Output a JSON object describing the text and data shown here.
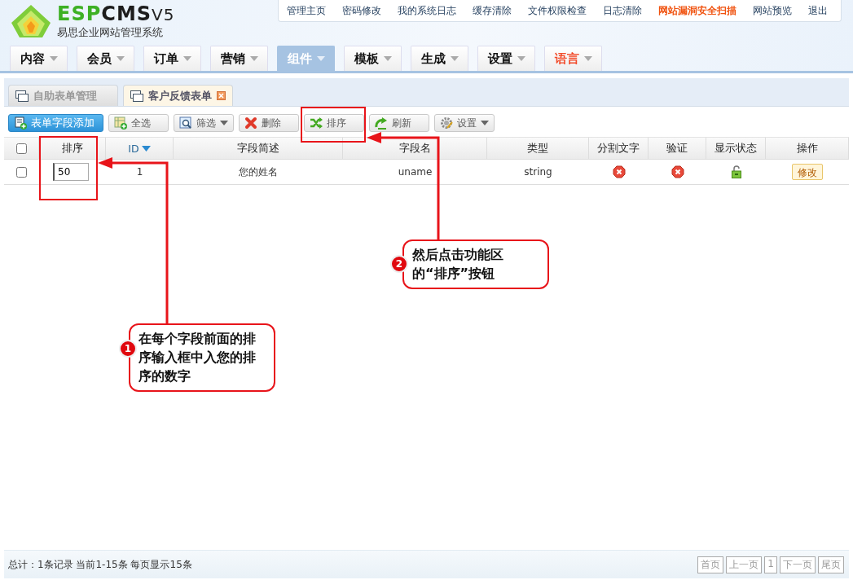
{
  "logo": {
    "brand": [
      {
        "text": "ESP",
        "color": "#3db024"
      },
      {
        "text": "CMS",
        "color": "#1d1d1d"
      }
    ],
    "version": "V5",
    "subtitle": "易思企业网站管理系统"
  },
  "top_links": [
    {
      "label": "管理主页",
      "highlighted": false
    },
    {
      "label": "密码修改",
      "highlighted": false
    },
    {
      "label": "我的系统日志",
      "highlighted": false
    },
    {
      "label": "缓存清除",
      "highlighted": false
    },
    {
      "label": "文件权限检查",
      "highlighted": false
    },
    {
      "label": "日志清除",
      "highlighted": false
    },
    {
      "label": "网站漏洞安全扫描",
      "highlighted": true
    },
    {
      "label": "网站预览",
      "highlighted": false
    },
    {
      "label": "退出",
      "highlighted": false
    }
  ],
  "nav_tabs": [
    {
      "label": "内容",
      "selected": false,
      "highlighted": false
    },
    {
      "label": "会员",
      "selected": false,
      "highlighted": false
    },
    {
      "label": "订单",
      "selected": false,
      "highlighted": false
    },
    {
      "label": "营销",
      "selected": false,
      "highlighted": false
    },
    {
      "label": "组件",
      "selected": true,
      "highlighted": false
    },
    {
      "label": "模板",
      "selected": false,
      "highlighted": false
    },
    {
      "label": "生成",
      "selected": false,
      "highlighted": false
    },
    {
      "label": "设置",
      "selected": false,
      "highlighted": false
    },
    {
      "label": "语言",
      "selected": false,
      "highlighted": true
    }
  ],
  "sub_tabs": [
    {
      "label": "自助表单管理",
      "selected": false,
      "closable": false
    },
    {
      "label": "客户反馈表单",
      "selected": true,
      "closable": true
    }
  ],
  "toolbar": [
    {
      "label": "表单字段添加",
      "kind": "add",
      "primary": true,
      "dropdown": false
    },
    {
      "label": "全选",
      "kind": "select-all",
      "primary": false,
      "dropdown": false
    },
    {
      "label": "筛选",
      "kind": "filter",
      "primary": false,
      "dropdown": true
    },
    {
      "label": "删除",
      "kind": "delete",
      "primary": false,
      "dropdown": false
    },
    {
      "label": "排序",
      "kind": "sort",
      "primary": false,
      "dropdown": false
    },
    {
      "label": "刷新",
      "kind": "refresh",
      "primary": false,
      "dropdown": false
    },
    {
      "label": "设置",
      "kind": "settings",
      "primary": false,
      "dropdown": true
    }
  ],
  "table": {
    "header_checked": false,
    "columns": [
      {
        "label": "排序",
        "sorted": false
      },
      {
        "label": "ID",
        "sorted": true
      },
      {
        "label": "字段简述",
        "sorted": false
      },
      {
        "label": "字段名",
        "sorted": false
      },
      {
        "label": "类型",
        "sorted": false
      },
      {
        "label": "分割文字",
        "sorted": false
      },
      {
        "label": "验证",
        "sorted": false
      },
      {
        "label": "显示状态",
        "sorted": false
      },
      {
        "label": "操作",
        "sorted": false
      }
    ],
    "rows": [
      {
        "checked": false,
        "order": "50",
        "id": "1",
        "description": "您的姓名",
        "field_name": "uname",
        "type": "string",
        "split_text": false,
        "validate": false,
        "visible": true,
        "action": "修改"
      }
    ]
  },
  "footer": {
    "summary": "总计：1条记录 当前1-15条 每页显示15条",
    "pages": [
      "首页",
      "上一页",
      "1",
      "下一页",
      "尾页"
    ]
  },
  "callouts": [
    {
      "number": "1",
      "text": "在每个字段前面的排序输入框中入您的排序的数字"
    },
    {
      "number": "2",
      "text": "然后点击功能区的“排序”按钮"
    }
  ]
}
